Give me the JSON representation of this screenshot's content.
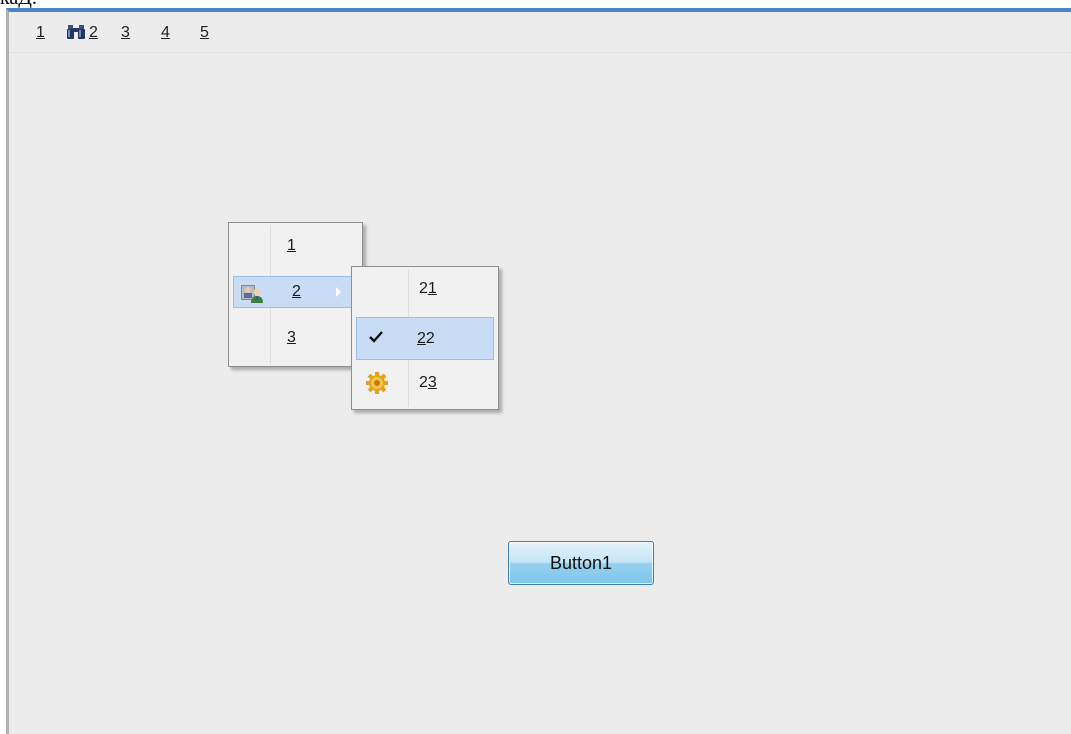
{
  "page": {
    "top_fragment": "каД."
  },
  "menubar": {
    "item1": "1",
    "item2": "2",
    "item3": "3",
    "item4": "4",
    "item5": "5",
    "binoculars_icon": "binoculars-icon"
  },
  "context_menu": {
    "items": [
      {
        "label": "1",
        "icon": ""
      },
      {
        "label": "2",
        "icon": "users-icon",
        "highlighted": true,
        "has_submenu": true
      },
      {
        "label": "3",
        "icon": ""
      }
    ]
  },
  "submenu": {
    "items": [
      {
        "prefix": "2",
        "mnemonic": "1",
        "icon": ""
      },
      {
        "prefix": "",
        "mnemonic": "2",
        "suffix": "2",
        "icon": "check-icon",
        "highlighted": true,
        "checked": true
      },
      {
        "prefix": "2",
        "mnemonic": "3",
        "icon": "gear-icon"
      }
    ]
  },
  "button1": {
    "label": "Button1"
  },
  "colors": {
    "window_bg": "#ececec",
    "title_accent": "#4a86c7",
    "highlight_bg": "#c8ddf5",
    "highlight_border": "#99c0eb",
    "button_border": "#3c7fb1"
  }
}
